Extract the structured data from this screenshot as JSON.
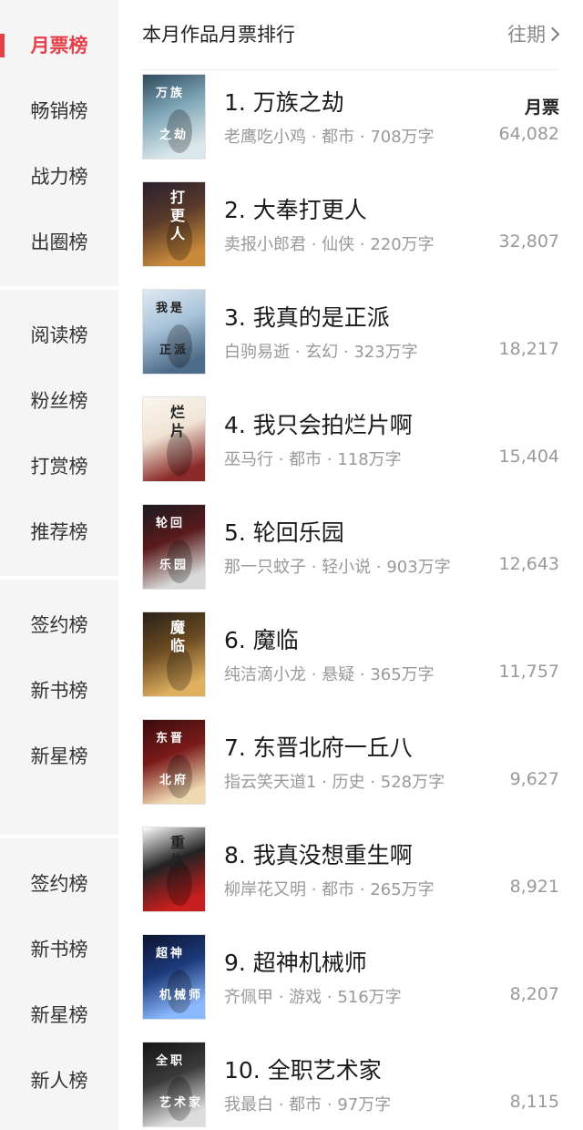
{
  "sidebar": {
    "items": [
      {
        "label": "月票榜",
        "active": true
      },
      {
        "label": "畅销榜"
      },
      {
        "label": "战力榜"
      },
      {
        "label": "出圈榜"
      },
      {
        "label": "阅读榜"
      },
      {
        "label": "粉丝榜"
      },
      {
        "label": "打赏榜"
      },
      {
        "label": "推荐榜"
      },
      {
        "label": "签约榜"
      },
      {
        "label": "新书榜"
      },
      {
        "label": "新星榜"
      },
      {
        "label": "签约榜"
      },
      {
        "label": "新书榜"
      },
      {
        "label": "新星榜"
      },
      {
        "label": "新人榜"
      }
    ]
  },
  "header": {
    "title": "本月作品月票排行",
    "past_label": "往期"
  },
  "list": {
    "votes_label": "月票",
    "books": [
      {
        "title": "1. 万族之劫",
        "meta": "老鹰吃小鸡 · 都市 · 708万字",
        "votes": "64,082",
        "cover_text": "万族之劫",
        "cover_colors": [
          "#2d4a5c",
          "#7fa6b8",
          "#d9e6ea"
        ]
      },
      {
        "title": "2. 大奉打更人",
        "meta": "卖报小郎君 · 仙侠 · 220万字",
        "votes": "32,807",
        "cover_text": "打更人",
        "cover_colors": [
          "#2a1f2e",
          "#5a3a2a",
          "#c98a3a"
        ]
      },
      {
        "title": "3. 我真的是正派",
        "meta": "白驹易逝 · 玄幻 · 323万字",
        "votes": "18,217",
        "cover_text": "我是正派",
        "cover_colors": [
          "#dfe9f2",
          "#a8c3d9",
          "#4d6c8a"
        ]
      },
      {
        "title": "4. 我只会拍烂片啊",
        "meta": "巫马行 · 都市 · 118万字",
        "votes": "15,404",
        "cover_text": "烂片",
        "cover_colors": [
          "#fbf6f0",
          "#f0e4d4",
          "#8a2a2a"
        ]
      },
      {
        "title": "5. 轮回乐园",
        "meta": "那一只蚊子 · 轻小说 · 903万字",
        "votes": "12,643",
        "cover_text": "轮回乐园",
        "cover_colors": [
          "#1b1b22",
          "#5a1a1a",
          "#d9d9d9"
        ]
      },
      {
        "title": "6. 魔临",
        "meta": "纯洁滴小龙 · 悬疑 · 365万字",
        "votes": "11,757",
        "cover_text": "魔临",
        "cover_colors": [
          "#2a2218",
          "#6a4a22",
          "#e0b060"
        ]
      },
      {
        "title": "7. 东晋北府一丘八",
        "meta": "指云笑天道1 · 历史 · 528万字",
        "votes": "9,627",
        "cover_text": "东晋北府",
        "cover_colors": [
          "#3a0c0c",
          "#7a1a1a",
          "#f0d8b0"
        ]
      },
      {
        "title": "8. 我真没想重生啊",
        "meta": "柳岸花又明 · 都市 · 265万字",
        "votes": "8,921",
        "cover_text": "重生",
        "cover_colors": [
          "#ffffff",
          "#222222",
          "#c81e1e"
        ]
      },
      {
        "title": "9. 超神机械师",
        "meta": "齐佩甲 · 游戏 · 516万字",
        "votes": "8,207",
        "cover_text": "超神机械师",
        "cover_colors": [
          "#0c1430",
          "#1c3a7a",
          "#8ab8ff"
        ]
      },
      {
        "title": "10. 全职艺术家",
        "meta": "我最白 · 都市 · 97万字",
        "votes": "8,115",
        "cover_text": "全职艺术家",
        "cover_colors": [
          "#141414",
          "#3a3a3a",
          "#dcdcdc"
        ]
      }
    ]
  },
  "colors": {
    "accent": "#e8404a",
    "sidebar_bg": "#f5f5f5",
    "meta_text": "#999999"
  }
}
